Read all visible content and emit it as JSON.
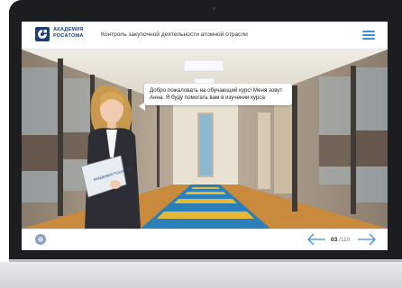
{
  "header": {
    "logo_line1": "АКАДЕМИЯ",
    "logo_line2": "РОСАТОМА",
    "course_title": "Контроль закупочной деятельности атомной отрасли",
    "menu_icon": "hamburger-menu-icon"
  },
  "scene": {
    "speech_text": "Добро пожаловать на обучающий курс! Меня зовут Анна. Я буду помогать вам в изучении курса",
    "folder_text": "АКАДЕМИЯ РОСАТОМ"
  },
  "footer": {
    "current_page": "03",
    "separator": " /",
    "total_pages": "110",
    "prev_icon": "arrow-left-icon",
    "next_icon": "arrow-right-icon"
  },
  "colors": {
    "accent": "#3d8fd6",
    "brand": "#1b3f74",
    "floor_blue": "#2a7fb8",
    "floor_yellow": "#e6b83a"
  }
}
